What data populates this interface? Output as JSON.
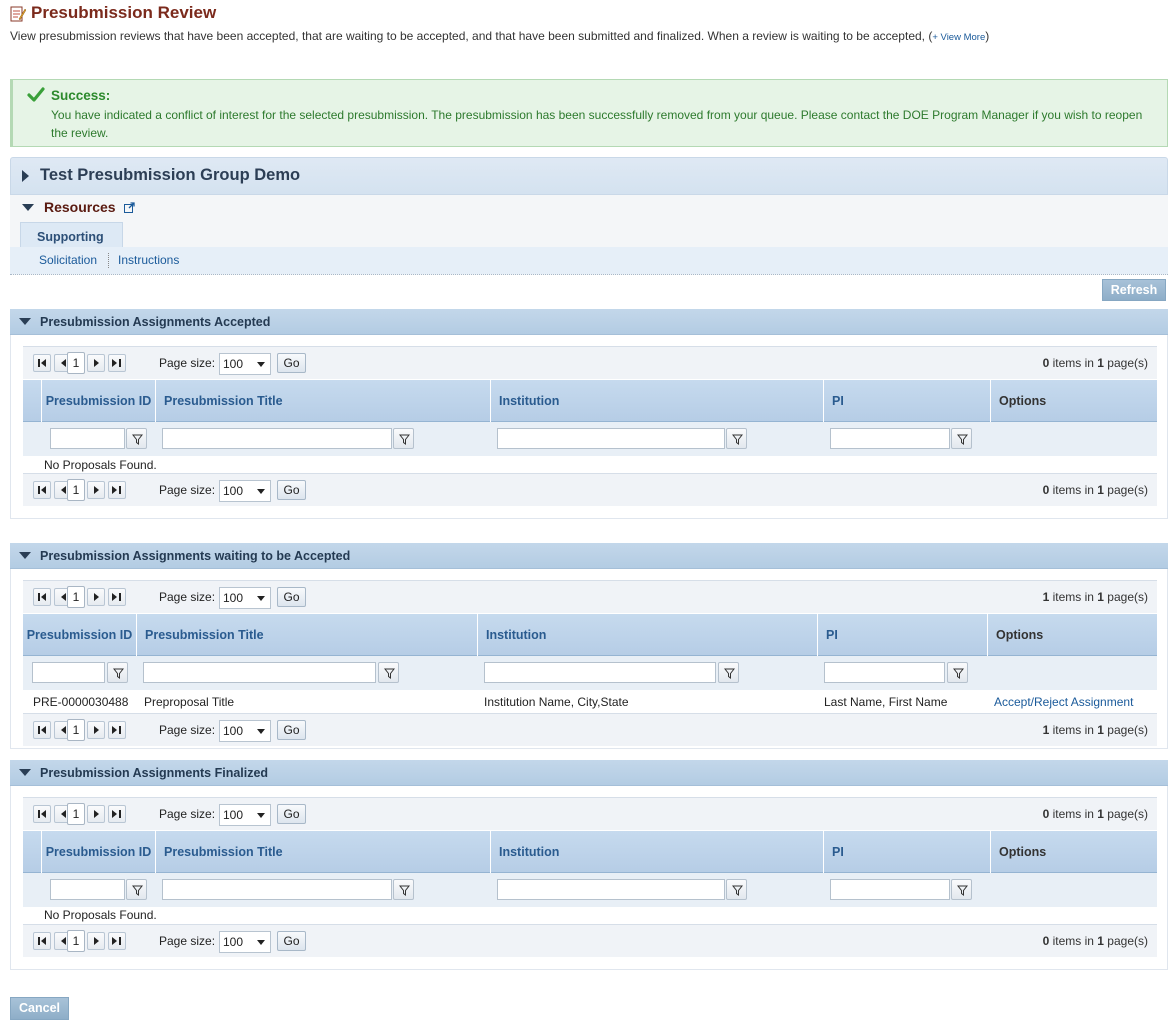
{
  "page": {
    "title": "Presubmission Review",
    "description": "View presubmission reviews that have been accepted, that are waiting to be accepted, and that have been submitted and finalized. When a review is waiting to be accepted, (",
    "view_more": "+ View More",
    "desc_close": ")"
  },
  "success": {
    "title": "Success:",
    "message": "You have indicated a conflict of interest for the selected presubmission. The presubmission has been successfully removed from your queue. Please contact the DOE Program Manager if you wish to reopen the review."
  },
  "group": {
    "title": "Test Presubmission Group Demo"
  },
  "resources": {
    "title": "Resources",
    "tab": "Supporting",
    "links": [
      "Solicitation",
      "Instructions"
    ]
  },
  "refresh_label": "Refresh",
  "cancel_label": "Cancel",
  "pager": {
    "page_size_label": "Page size:",
    "page_size_value": "100",
    "go_label": "Go",
    "current_page": "1"
  },
  "columns": {
    "id": "Presubmission ID",
    "title": "Presubmission Title",
    "institution": "Institution",
    "pi": "PI",
    "options": "Options"
  },
  "sections": {
    "accepted": {
      "title": "Presubmission Assignments Accepted",
      "items_count": "0",
      "pages_count": "1",
      "empty_text": "No Proposals Found."
    },
    "waiting": {
      "title": "Presubmission Assignments waiting to be Accepted",
      "items_count": "1",
      "pages_count": "1",
      "row": {
        "id": "PRE-0000030488",
        "title": "Preproposal Title",
        "institution": "Institution Name, City,State",
        "pi": "Last Name, First Name",
        "action": "Accept/Reject Assignment"
      }
    },
    "finalized": {
      "title": "Presubmission Assignments Finalized",
      "items_count": "0",
      "pages_count": "1",
      "empty_text": "No Proposals Found."
    }
  },
  "items_text": {
    "items_in": " items in ",
    "pages": " page(s)"
  },
  "colors": {
    "title_brown": "#7b2a1c",
    "success_green": "#2d8a2d",
    "link_blue": "#1a5a9a",
    "header_blue": "#2a5b8f"
  }
}
